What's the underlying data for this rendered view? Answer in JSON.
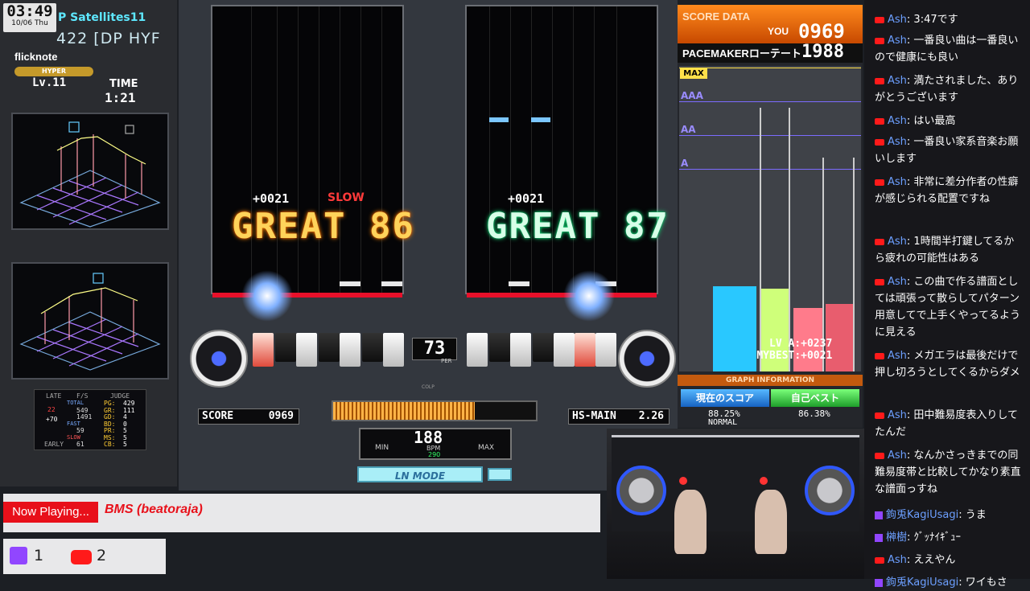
{
  "clock": {
    "time": "03:49",
    "date": "10/06 Thu"
  },
  "song": {
    "title": "P Satellites11",
    "subtitle": "422 [DP HYF",
    "artist": "flicknote",
    "difficulty": "HYPER",
    "level": "Lv.11"
  },
  "time": {
    "label": "TIME",
    "value": "1:21"
  },
  "judge": {
    "header_late": "LATE",
    "header_fs": "F/S",
    "header_judge": "JUDGE",
    "early": "EARLY",
    "left_vals": [
      "22",
      "+70"
    ],
    "rows": [
      {
        "label": "TOTAL",
        "fs": "",
        "key": "PG:",
        "val": "429"
      },
      {
        "label": "",
        "fs": "549",
        "key": "GR:",
        "val": "111"
      },
      {
        "label": "",
        "fs": "1491",
        "key": "GD:",
        "val": "4"
      },
      {
        "label": "FAST",
        "fs": "",
        "key": "BD:",
        "val": "0"
      },
      {
        "label": "",
        "fs": "59",
        "key": "PR:",
        "val": "5"
      },
      {
        "label": "SLOW",
        "fs": "",
        "key": "MS:",
        "val": "5"
      },
      {
        "label": "",
        "fs": "61",
        "key": "CB:",
        "val": "5"
      }
    ]
  },
  "play": {
    "left_timing": "+0021",
    "left_slow": "SLOW",
    "left_judge": "GREAT 86",
    "right_timing": "+0021",
    "right_judge": "GREAT 87",
    "green_number": "73",
    "per": "PER",
    "score_label": "SCORE",
    "score_value": "0969",
    "hs_label": "HS-MAIN",
    "hs_value": "2.26",
    "gauge_percent": 70,
    "bpm": {
      "value": "188",
      "min": "MIN",
      "label": "BPM",
      "max": "MAX",
      "sub": "290"
    },
    "ln_mode": "LN MODE",
    "colp": "COLP"
  },
  "score_data": {
    "title": "SCORE DATA",
    "you_label": "YOU",
    "you_score": "0969",
    "pacemaker_label": "PACEMAKERローテート",
    "pacemaker_score": "1988",
    "ranks": [
      "MAX",
      "AAA",
      "AA",
      "A"
    ],
    "bars": [
      {
        "name": "current",
        "color": "#29c8ff",
        "value": 0.44
      },
      {
        "name": "best",
        "color": "#cfff7a",
        "value": 0.43
      },
      {
        "name": "target-a",
        "color": "#ff7b8b",
        "value": 0.33
      },
      {
        "name": "target-b",
        "color": "#e85d6e",
        "value": 0.35
      }
    ],
    "lv_a": "LV A:+0237",
    "mybest": "MYBEST:+0021",
    "graph_info": "GRAPH INFORMATION",
    "current_label": "現在のスコア",
    "best_label": "自己ベスト",
    "current_pct": "88.25%",
    "best_pct": "86.38%",
    "current_mode": "NORMAL"
  },
  "chat": [
    {
      "platform": "yt",
      "user": "Ash",
      "text": "3:47です"
    },
    {
      "platform": "yt",
      "user": "Ash",
      "text": "一番良い曲は一番良いので健康にも良い"
    },
    {
      "platform": "yt",
      "user": "Ash",
      "text": "満たされました、ありがとうございます"
    },
    {
      "platform": "yt",
      "user": "Ash",
      "text": "はい最高"
    },
    {
      "platform": "yt",
      "user": "Ash",
      "text": "一番良い家系音楽お願いします"
    },
    {
      "platform": "yt",
      "user": "Ash",
      "text": "非常に差分作者の性癖が感じられる配置ですね"
    },
    {
      "platform": "yt",
      "user": "Ash",
      "text": "1時間半打鍵してるから疲れの可能性はある"
    },
    {
      "platform": "yt",
      "user": "Ash",
      "text": "この曲で作る譜面としては頑張って散らしてパターン用意してで上手くやってるように見える"
    },
    {
      "platform": "yt",
      "user": "Ash",
      "text": "メガエラは最後だけで押し切ろうとしてくるからダメ"
    },
    {
      "platform": "yt",
      "user": "Ash",
      "text": "田中難易度表入りしてたんだ"
    },
    {
      "platform": "yt",
      "user": "Ash",
      "text": "なんかさっきまでの同難易度帯と比較してかなり素直な譜面っすね"
    },
    {
      "platform": "tw",
      "user": "鉤兎KagiUsagi",
      "text": "うま"
    },
    {
      "platform": "tw",
      "user": "榊樹",
      "text": "ｸﾞｯﾅｲｷﾞｭｰ"
    },
    {
      "platform": "yt",
      "user": "Ash",
      "text": "ええやん"
    },
    {
      "platform": "tw",
      "user": "鉤兎KagiUsagi",
      "text": "ワイもさ"
    }
  ],
  "now_playing": {
    "label": "Now Playing...",
    "text": "BMS (beatoraja)"
  },
  "viewers": {
    "twitch": "1",
    "youtube": "2"
  }
}
